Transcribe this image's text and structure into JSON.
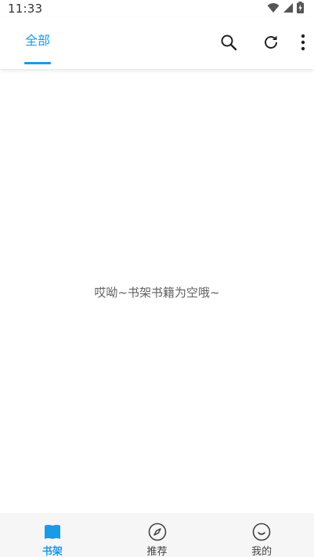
{
  "status_bar": {
    "time": "11:33",
    "icons": [
      "wifi-icon",
      "signal-icon",
      "battery-charging-icon"
    ]
  },
  "top_bar": {
    "tab_all_label": "全部",
    "actions": [
      "search-icon",
      "refresh-icon",
      "more-vert-icon"
    ]
  },
  "bookshelf": {
    "empty_message": "哎呦~书架书籍为空哦~"
  },
  "bottom_nav": {
    "items": [
      {
        "label": "书架",
        "icon": "book-icon",
        "active": true
      },
      {
        "label": "推荐",
        "icon": "compass-icon",
        "active": false
      },
      {
        "label": "我的",
        "icon": "smiley-icon",
        "active": false
      }
    ]
  },
  "colors": {
    "accent": "#1a9be6",
    "nav_background": "#f6f6f6",
    "empty_text": "#616161"
  }
}
